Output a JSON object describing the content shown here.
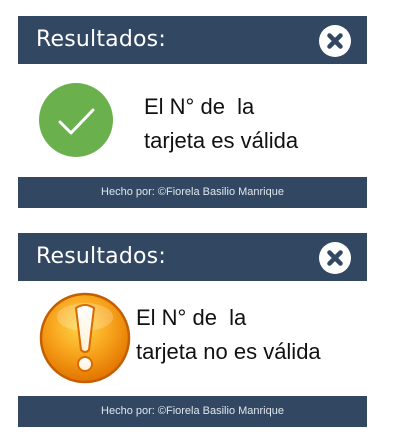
{
  "dialogs": [
    {
      "title": "Resultados:",
      "close_icon": "close-icon",
      "status_icon": "check-circle-icon",
      "message_line1": "El N° de  la",
      "message_line2": "tarjeta es válida",
      "footer": "Hecho por: ©Fiorela Basilio Manrique"
    },
    {
      "title": "Resultados:",
      "close_icon": "close-icon",
      "status_icon": "warning-exclamation-icon",
      "message_line1": "El N° de  la",
      "message_line2": "tarjeta no es válida",
      "footer": "Hecho por: ©Fiorela Basilio Manrique"
    }
  ],
  "colors": {
    "header_bg": "#324862",
    "success_green": "#6ab04c",
    "warning_orange": "#f5a623"
  }
}
